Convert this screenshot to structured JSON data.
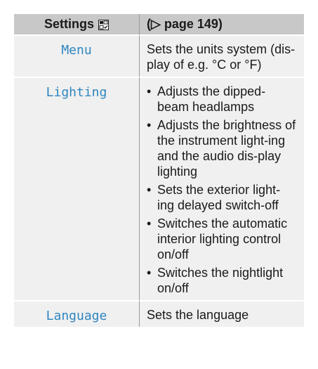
{
  "header": {
    "left_label": "Settings",
    "right_label": "(▷ page 149)",
    "icon": "settings-menu-icon"
  },
  "rows": [
    {
      "term": "Menu",
      "description": "Sets the units system (dis-play of e.g. °C or °F)"
    },
    {
      "term": "Lighting",
      "bullets": [
        "Adjusts the dipped-beam headlamps",
        "Adjusts the brightness of the instrument light-ing and the audio dis-play lighting",
        "Sets the exterior light-ing delayed switch-off",
        "Switches the automatic interior lighting control on/off",
        "Switches the nightlight on/off"
      ]
    },
    {
      "term": "Language",
      "description": "Sets the language"
    }
  ],
  "colors": {
    "header_bg": "#c8c8c8",
    "row_bg": "#f0f0f0",
    "term_text": "#2f86c0"
  }
}
